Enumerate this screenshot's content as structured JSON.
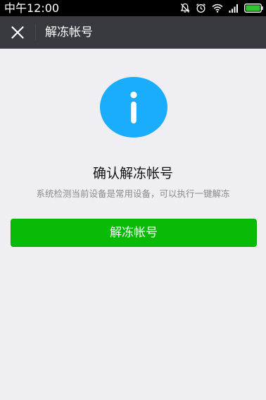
{
  "status_bar": {
    "time": "中午12:00",
    "icons": [
      "mute-icon",
      "alarm-icon",
      "wifi-icon",
      "signal-icon",
      "battery-icon"
    ]
  },
  "title_bar": {
    "close_icon": "close-icon",
    "title": "解冻帐号"
  },
  "main": {
    "icon": "info-icon",
    "icon_color": "#1aadfb",
    "headline": "确认解冻帐号",
    "description": "系统检测当前设备是常用设备，可以执行一键解冻",
    "button_label": "解冻帐号",
    "button_color": "#09bb07"
  }
}
